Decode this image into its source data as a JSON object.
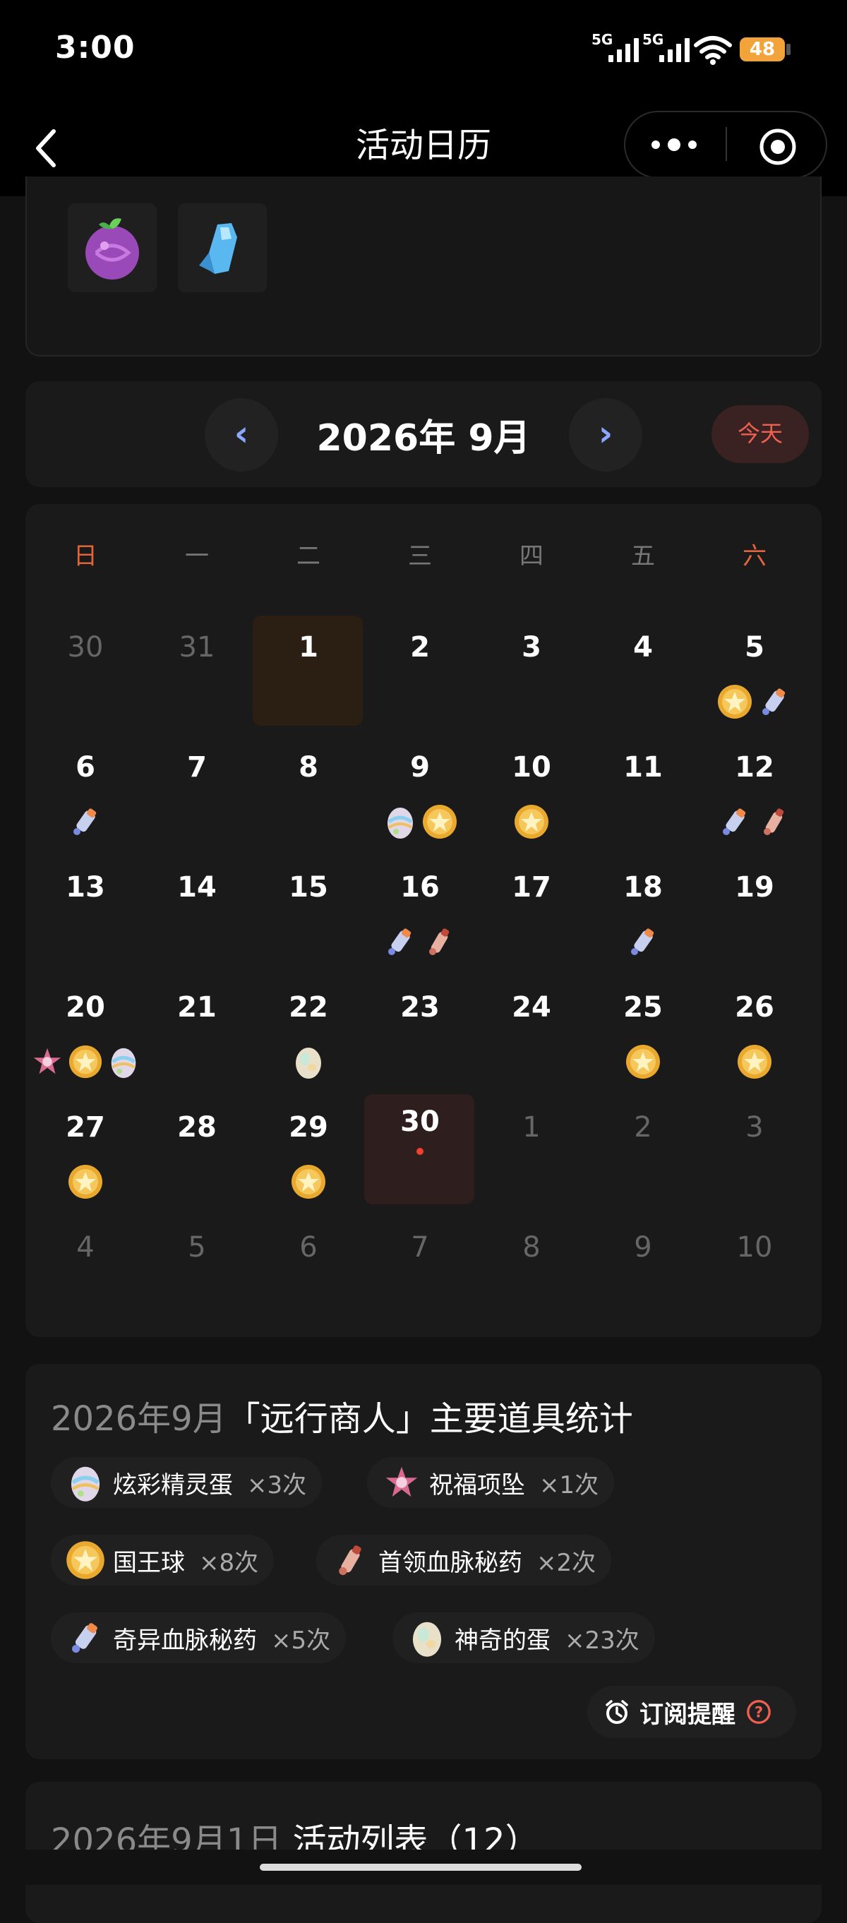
{
  "status_bar": {
    "time": "3:00",
    "signal1": "5G",
    "signal2": "5G",
    "battery": "48"
  },
  "nav": {
    "title": "活动日历",
    "back_icon": "chevron-left-icon",
    "more_icon": "more-dots-icon",
    "target_icon": "target-icon"
  },
  "top_items": [
    {
      "icon": "purple-fruit-icon"
    },
    {
      "icon": "blue-crystal-icon"
    }
  ],
  "month_bar": {
    "prev": "‹",
    "title": "2026年 9月",
    "next": "›",
    "today": "今天"
  },
  "weekdays": [
    "日",
    "一",
    "二",
    "三",
    "四",
    "五",
    "六"
  ],
  "weeks": [
    [
      {
        "d": "30",
        "dim": true
      },
      {
        "d": "31",
        "dim": true
      },
      {
        "d": "1",
        "sel": true
      },
      {
        "d": "2"
      },
      {
        "d": "3"
      },
      {
        "d": "4"
      },
      {
        "d": "5",
        "icons": [
          "kingball",
          "odd"
        ]
      }
    ],
    [
      {
        "d": "6",
        "icons": [
          "odd"
        ]
      },
      {
        "d": "7"
      },
      {
        "d": "8"
      },
      {
        "d": "9",
        "icons": [
          "coloregg",
          "kingball"
        ]
      },
      {
        "d": "10",
        "icons": [
          "kingball"
        ]
      },
      {
        "d": "11"
      },
      {
        "d": "12",
        "icons": [
          "odd",
          "leader"
        ]
      }
    ],
    [
      {
        "d": "13"
      },
      {
        "d": "14"
      },
      {
        "d": "15"
      },
      {
        "d": "16",
        "icons": [
          "odd",
          "leader"
        ]
      },
      {
        "d": "17"
      },
      {
        "d": "18",
        "icons": [
          "odd"
        ]
      },
      {
        "d": "19"
      }
    ],
    [
      {
        "d": "20",
        "icons": [
          "pendant",
          "kingball",
          "coloregg"
        ]
      },
      {
        "d": "21"
      },
      {
        "d": "22",
        "icons": [
          "egg"
        ]
      },
      {
        "d": "23"
      },
      {
        "d": "24"
      },
      {
        "d": "25",
        "icons": [
          "kingball"
        ]
      },
      {
        "d": "26",
        "icons": [
          "kingball"
        ]
      }
    ],
    [
      {
        "d": "27",
        "icons": [
          "kingball"
        ]
      },
      {
        "d": "28"
      },
      {
        "d": "29",
        "icons": [
          "kingball"
        ]
      },
      {
        "d": "30",
        "today": true
      },
      {
        "d": "1",
        "dim": true
      },
      {
        "d": "2",
        "dim": true
      },
      {
        "d": "3",
        "dim": true
      }
    ],
    [
      {
        "d": "4",
        "dim": true
      },
      {
        "d": "5",
        "dim": true
      },
      {
        "d": "6",
        "dim": true
      },
      {
        "d": "7",
        "dim": true
      },
      {
        "d": "8",
        "dim": true
      },
      {
        "d": "9",
        "dim": true
      },
      {
        "d": "10",
        "dim": true
      }
    ]
  ],
  "stats": {
    "title_date": "2026年9月",
    "title_main": "「远行商人」主要道具统计",
    "items": [
      {
        "icon": "coloregg",
        "name": "炫彩精灵蛋",
        "count": "×3次"
      },
      {
        "icon": "pendant",
        "name": "祝福项坠",
        "count": "×1次"
      },
      {
        "icon": "kingball",
        "name": "国王球",
        "count": "×8次"
      },
      {
        "icon": "leader",
        "name": "首领血脉秘药",
        "count": "×2次"
      },
      {
        "icon": "odd",
        "name": "奇异血脉秘药",
        "count": "×5次"
      },
      {
        "icon": "egg",
        "name": "神奇的蛋",
        "count": "×23次"
      }
    ],
    "subscribe": "订阅提醒"
  },
  "list": {
    "title_date": "2026年9月1日",
    "title_main": "活动列表（12）"
  },
  "colors": {
    "accent_red": "#f06050",
    "weekend_red": "#e0653c",
    "arrow_blue": "#8aa6ff",
    "gold": "#f2b73b"
  }
}
